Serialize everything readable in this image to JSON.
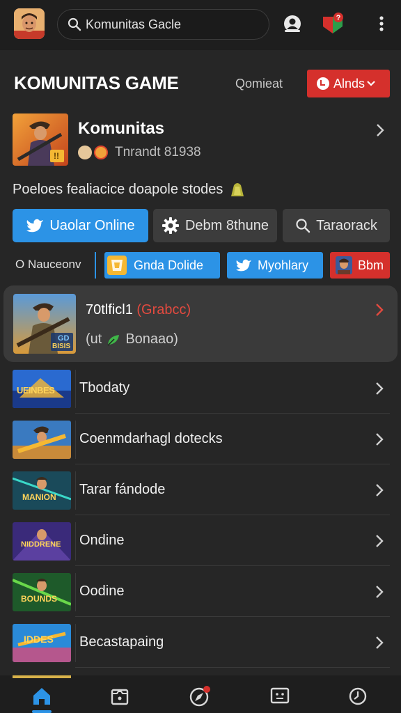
{
  "topbar": {
    "search_value": "Komunitas Gacle",
    "icons": [
      "search-icon",
      "user-icon",
      "flag-icon",
      "more-vertical-icon"
    ]
  },
  "header": {
    "title": "KOMUNITAS GAME",
    "link_label": "Qomieat",
    "button_label": "Alnds"
  },
  "community": {
    "name": "Komunitas",
    "meta": "Tnrandt 81938",
    "badge": "!!",
    "description": "Poeloes fealiacice doapole stodes"
  },
  "actions": [
    {
      "label": "Uaolar Online",
      "icon": "twitter-bird-icon"
    },
    {
      "label": "Debm 8thune",
      "icon": "gear-icon"
    },
    {
      "label": "Taraorack",
      "icon": "search-icon"
    }
  ],
  "chips": {
    "plain": "O Nauceonv",
    "items": [
      {
        "label": "Gnda Dolide"
      },
      {
        "label": "Myohlary"
      },
      {
        "label": "Bbm"
      }
    ]
  },
  "featured": {
    "title": "70tlficl1",
    "title_accent": "(Grabcc)",
    "subtitle_prefix": "(ut",
    "subtitle": "Bonaao)",
    "thumb_text_1": "GD",
    "thumb_text_2": "BISIS"
  },
  "list": [
    {
      "label": "Tbodaty",
      "thumb_text": "UEINBES"
    },
    {
      "label": "Coenmdarhagl dotecks",
      "thumb_text": ""
    },
    {
      "label": "Tarar fándode",
      "thumb_text": "MANION"
    },
    {
      "label": "Ondine",
      "thumb_text": "NIDDRENE"
    },
    {
      "label": "Oodine",
      "thumb_text": "BOUNDS"
    },
    {
      "label": "Becastapaing",
      "thumb_text": "IDDES"
    }
  ],
  "bottom_nav": [
    "home-icon",
    "inbox-icon",
    "compass-icon",
    "chat-icon",
    "clock-icon"
  ],
  "colors": {
    "accent_blue": "#2c93e6",
    "accent_red": "#d5302c",
    "background": "#262626"
  }
}
